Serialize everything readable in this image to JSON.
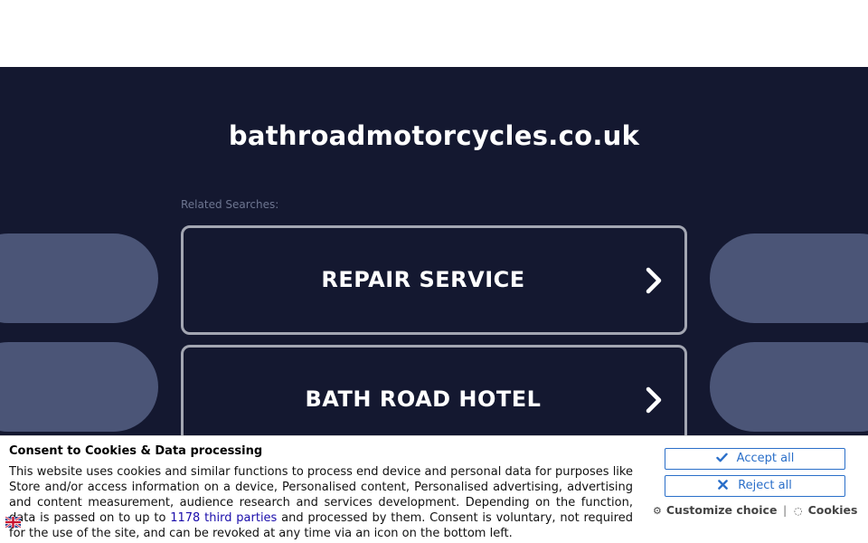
{
  "page": {
    "domain": "bathroadmotorcycles.co.uk",
    "related_label": "Related Searches:"
  },
  "searches": [
    {
      "label": "REPAIR SERVICE"
    },
    {
      "label": "BATH ROAD HOTEL"
    }
  ],
  "consent": {
    "title": "Consent to Cookies & Data processing",
    "text_before": "This website uses cookies and similar functions to process end device and personal data for purposes like Store and/or access information on a device, Personalised content, Personalised advertising, advertising and content measurement, audience research and services development. Depending on the function, data is passed on to up to ",
    "link_text": "1178 third parties",
    "text_after": " and processed by them. Consent is voluntary, not required for the use of the site, and can be revoked at any time via an icon on the bottom left.",
    "accept_label": "Accept all",
    "reject_label": "Reject all",
    "customize_label": "Customize choice",
    "separator": "|",
    "cookies_label": "Cookies"
  },
  "colors": {
    "background": "#141830",
    "decor": "#4b5577",
    "button_border": "#a3a6b2",
    "consent_accent": "#2a6fc9"
  },
  "icons": {
    "search_chevron": "chevron-right-icon",
    "accept": "checkmark-icon",
    "reject": "x-icon",
    "customize": "gear-icon",
    "cookies": "cookie-icon",
    "language": "uk-flag-icon"
  }
}
